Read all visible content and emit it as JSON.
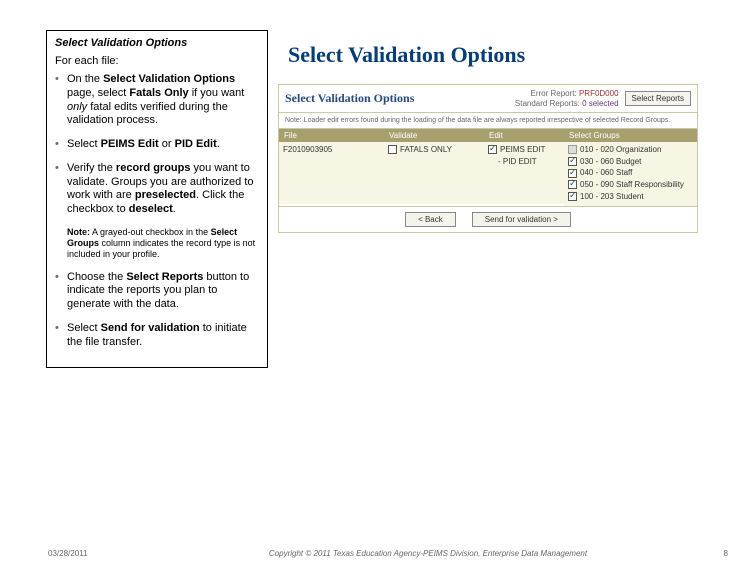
{
  "left": {
    "title": "Select Validation Options",
    "subtitle": "For each file:",
    "items": [
      "On the <b>Select Validation Options</b> page, select <b>Fatals Only</b> if you want <em>only</em> fatal edits verified during the validation process.",
      "Select <b>PEIMS Edit</b> or <b>PID Edit</b>.",
      "Verify the <b>record groups</b> you want to validate. Groups you are authorized to work with are <b>preselected</b>. Click the checkbox to <b>deselect</b>."
    ],
    "note": "<b>Note:</b> A grayed-out checkbox in the <b>Select Groups</b> column indicates the record type is not included in your profile.",
    "items2": [
      "Choose the <b>Select Reports</b> button to indicate the reports you plan to generate with the data.",
      "Select <b>Send for validation</b> to initiate the file transfer."
    ]
  },
  "right": {
    "bigTitle": "Select Validation Options"
  },
  "app": {
    "title": "Select Validation Options",
    "errorReportLabel": "Error Report:",
    "errorReportValue": "PRF0D000",
    "stdReportLabel": "Standard Reports:",
    "stdReportValue": "0 selected",
    "selectReportsBtn": "Select Reports",
    "noteText": "Note: Loader edit errors found during the loading of the data file are always reported irrespective of selected Record Groups.",
    "cols": {
      "c1": {
        "header": "File",
        "value": "F2010903905"
      },
      "c2": {
        "header": "Validate",
        "row1": "FATALS ONLY"
      },
      "c3": {
        "header": "Edit",
        "row1": "PEIMS EDIT",
        "row2": "PID EDIT"
      },
      "c4": {
        "header": "Select Groups",
        "rows": [
          {
            "label": "010 - 020 Organization"
          },
          {
            "label": "030 - 060 Budget"
          },
          {
            "label": "040 - 060 Staff"
          },
          {
            "label": "050 - 090 Staff Responsibility"
          },
          {
            "label": "100 - 203 Student"
          }
        ]
      }
    },
    "backBtn": "< Back",
    "sendBtn": "Send for validation >"
  },
  "footer": {
    "date": "03/28/2011",
    "copy": "Copyright © 2011 Texas Education Agency-PEIMS Division, Enterprise Data Management",
    "page": "8"
  }
}
